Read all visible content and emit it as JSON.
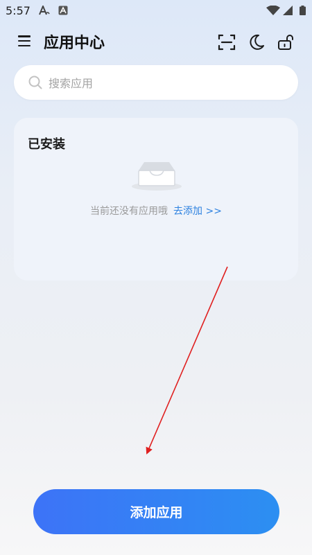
{
  "status_bar": {
    "time": "5:57"
  },
  "header": {
    "title": "应用中心"
  },
  "search": {
    "placeholder": "搜索应用",
    "value": ""
  },
  "installed": {
    "title": "已安装",
    "empty_message": "当前还没有应用哦",
    "add_link": "去添加 >>"
  },
  "footer": {
    "add_button_label": "添加应用"
  },
  "icons": {
    "menu": "menu-icon",
    "scan": "scan-icon",
    "dark_mode": "moon-icon",
    "lock": "unlock-icon",
    "search": "search-icon",
    "empty": "empty-box-icon"
  },
  "colors": {
    "accent": "#2e82e0",
    "button_start": "#3d73f7",
    "button_end": "#2c8ff2",
    "annotation_arrow": "#e02020"
  }
}
